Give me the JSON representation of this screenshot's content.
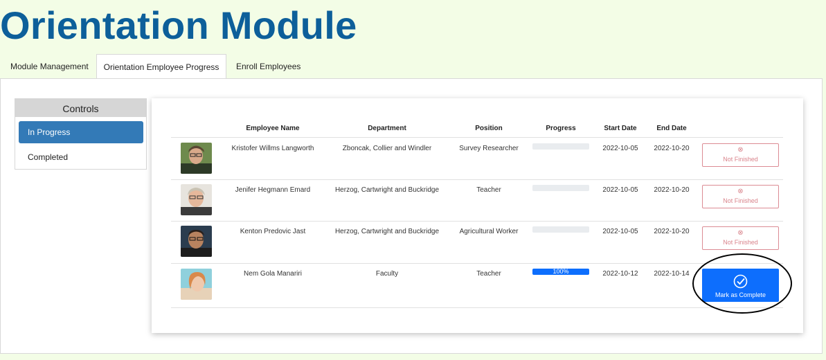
{
  "page": {
    "title": "Orientation Module"
  },
  "tabs": [
    {
      "label": "Module Management",
      "active": false
    },
    {
      "label": "Orientation Employee Progress",
      "active": true
    },
    {
      "label": "Enroll Employees",
      "active": false
    }
  ],
  "controls": {
    "header": "Controls",
    "items": [
      {
        "label": "In Progress",
        "active": true
      },
      {
        "label": "Completed",
        "active": false
      }
    ]
  },
  "table": {
    "columns": [
      "Employee Name",
      "Department",
      "Position",
      "Progress",
      "Start Date",
      "End Date"
    ],
    "rows": [
      {
        "name": "Kristofer Willms Langworth",
        "department": "Zboncak, Collier and Windler",
        "position": "Survey Researcher",
        "progress": 0,
        "progress_label": "",
        "start": "2022-10-05",
        "end": "2022-10-20",
        "action": "Not Finished",
        "action_icon": "x-circle-icon"
      },
      {
        "name": "Jenifer Hegmann Emard",
        "department": "Herzog, Cartwright and Buckridge",
        "position": "Teacher",
        "progress": 0,
        "progress_label": "",
        "start": "2022-10-05",
        "end": "2022-10-20",
        "action": "Not Finished",
        "action_icon": "x-circle-icon"
      },
      {
        "name": "Kenton Predovic Jast",
        "department": "Herzog, Cartwright and Buckridge",
        "position": "Agricultural Worker",
        "progress": 0,
        "progress_label": "",
        "start": "2022-10-05",
        "end": "2022-10-20",
        "action": "Not Finished",
        "action_icon": "x-circle-icon"
      },
      {
        "name": "Nem Gola Manariri",
        "department": "Faculty",
        "position": "Teacher",
        "progress": 100,
        "progress_label": "100%",
        "start": "2022-10-12",
        "end": "2022-10-14",
        "action": "Mark as Complete",
        "action_icon": "check-circle-icon"
      }
    ]
  },
  "colors": {
    "title": "#0d5f9a",
    "active_control": "#337ab7",
    "primary_button": "#0d6efd",
    "not_finished": "#dc8b93",
    "page_bg": "#f3fde6"
  }
}
